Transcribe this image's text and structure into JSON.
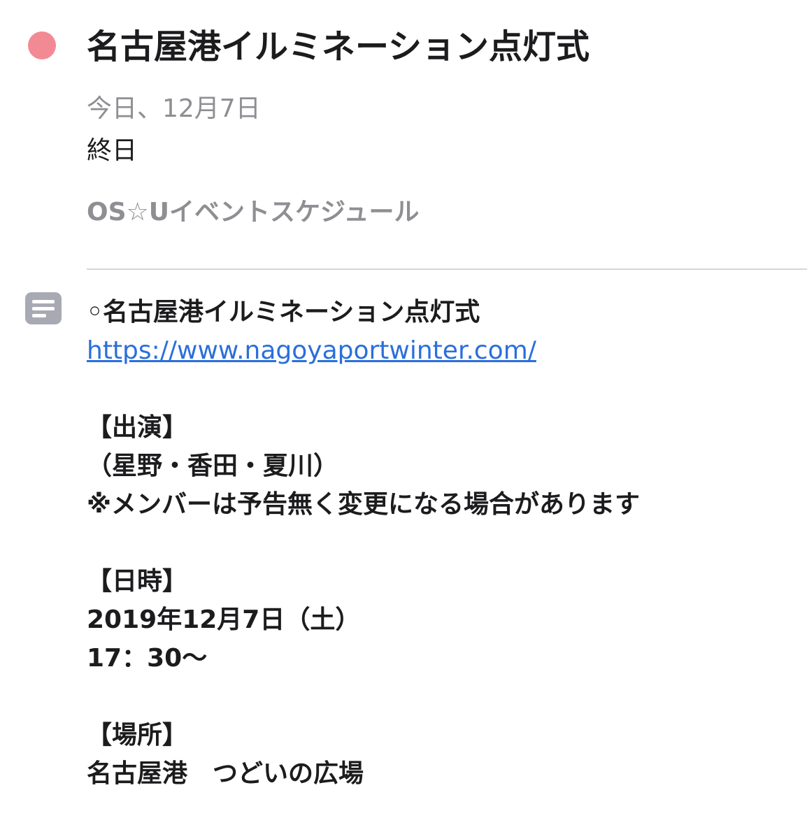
{
  "event": {
    "color": "#f28a94",
    "title": "名古屋港イルミネーション点灯式",
    "date": "今日、12月7日",
    "time": "終日",
    "calendar": "OS☆Uイベントスケジュール"
  },
  "notes": {
    "icon": "notes-icon",
    "heading": "◦名古屋港イルミネーション点灯式",
    "url": "https://www.nagoyaportwinter.com/",
    "cast_label": "【出演】",
    "cast": "（星野・香田・夏川）",
    "cast_note": "※メンバーは予告無く変更になる場合があります",
    "datetime_label": "【日時】",
    "date": "2019年12月7日（土）",
    "time": "17：30〜",
    "place_label": "【場所】",
    "place": "名古屋港　つどいの広場"
  }
}
